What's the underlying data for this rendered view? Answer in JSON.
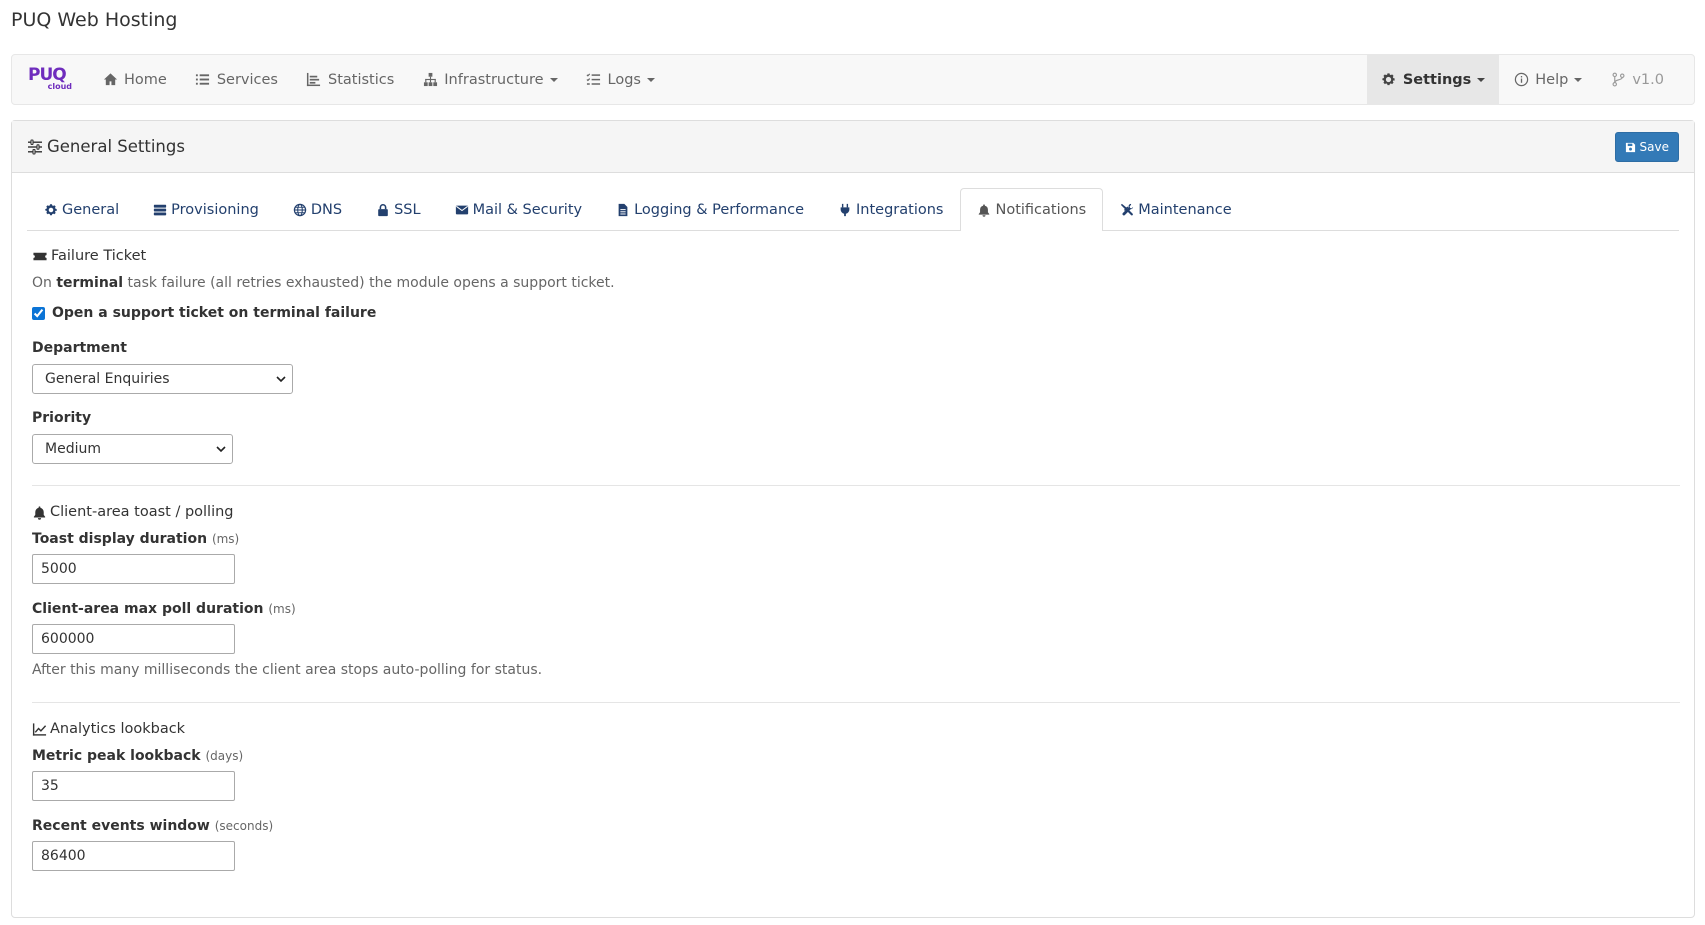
{
  "app_title": "PUQ Web Hosting",
  "navbar": {
    "brand_main": "PUQ",
    "brand_sub": "cloud",
    "items": [
      {
        "label": "Home",
        "icon": "home-icon"
      },
      {
        "label": "Services",
        "icon": "list-icon"
      },
      {
        "label": "Statistics",
        "icon": "chart-icon"
      },
      {
        "label": "Infrastructure",
        "icon": "sitemap-icon"
      },
      {
        "label": "Logs",
        "icon": "tasks-icon"
      }
    ],
    "settings_label": "Settings",
    "help_label": "Help",
    "version_label": "v1.0"
  },
  "panel": {
    "title": "General Settings",
    "save_label": "Save"
  },
  "tabs": [
    {
      "label": "General",
      "icon": "cog-icon"
    },
    {
      "label": "Provisioning",
      "icon": "server-icon"
    },
    {
      "label": "DNS",
      "icon": "globe-icon"
    },
    {
      "label": "SSL",
      "icon": "lock-icon"
    },
    {
      "label": "Mail & Security",
      "icon": "envelope-icon"
    },
    {
      "label": "Logging & Performance",
      "icon": "file-icon"
    },
    {
      "label": "Integrations",
      "icon": "plug-icon"
    },
    {
      "label": "Notifications",
      "icon": "bell-icon",
      "active": true
    },
    {
      "label": "Maintenance",
      "icon": "wrench-icon"
    }
  ],
  "failure_ticket": {
    "title": "Failure Ticket",
    "help_prefix": "On ",
    "help_bold": "terminal",
    "help_suffix": " task failure (all retries exhausted) the module opens a support ticket.",
    "checkbox_label": "Open a support ticket on terminal failure",
    "checkbox_checked": true,
    "department_label": "Department",
    "department_value": "General Enquiries",
    "priority_label": "Priority",
    "priority_value": "Medium"
  },
  "toast": {
    "title": "Client-area toast / polling",
    "duration_label": "Toast display duration",
    "duration_unit": "(ms)",
    "duration_value": "5000",
    "poll_label": "Client-area max poll duration",
    "poll_unit": "(ms)",
    "poll_value": "600000",
    "poll_help": "After this many milliseconds the client area stops auto-polling for status."
  },
  "analytics": {
    "title": "Analytics lookback",
    "peak_label": "Metric peak lookback",
    "peak_unit": "(days)",
    "peak_value": "35",
    "events_label": "Recent events window",
    "events_unit": "(seconds)",
    "events_value": "86400"
  },
  "colors": {
    "link": "#23406e",
    "brand": "#6f2dbd",
    "primary_button": "#337ab7"
  }
}
